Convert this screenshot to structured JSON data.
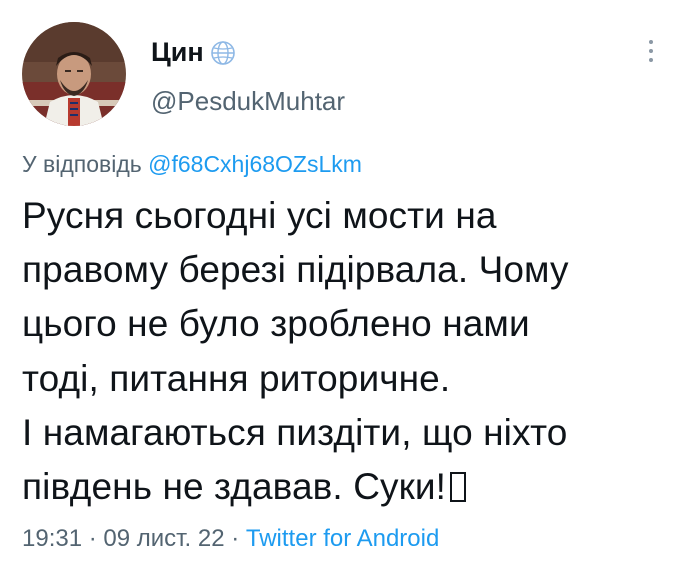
{
  "author": {
    "display_name": "Цин",
    "handle": "@PesdukMuhtar",
    "badge_icon": "globe-icon",
    "avatar_icon": "avatar"
  },
  "reply": {
    "prefix": "У відповідь",
    "mention": "@f68Cxhj68OZsLkm"
  },
  "tweet": {
    "lines": [
      "Русня сьогодні усі мости на",
      "правому березі підірвала. Чому",
      "цього не було зроблено нами",
      "тоді, питання риторичне.",
      "І намагаються пиздіти, що ніхто",
      "південь не здавав. Суки!"
    ],
    "trailing_glyph_icon": "missing-emoji-box-icon"
  },
  "meta": {
    "time": "19:31",
    "separator": "·",
    "date": "09 лист. 22",
    "source": "Twitter for Android"
  },
  "colors": {
    "text": "#0f1419",
    "secondary": "#536471",
    "link": "#1d9bf0",
    "background": "#ffffff"
  },
  "menu": {
    "icon": "more-options-icon"
  }
}
